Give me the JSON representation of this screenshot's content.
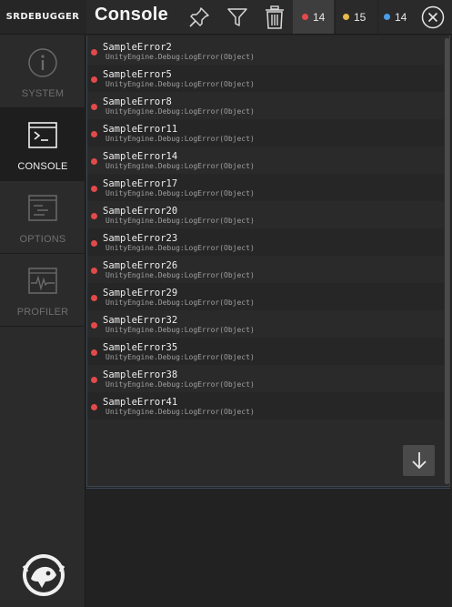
{
  "sidebar": {
    "brand": "SRDEBUGGER",
    "items": [
      {
        "label": "SYSTEM",
        "icon": "info-icon",
        "active": false
      },
      {
        "label": "CONSOLE",
        "icon": "terminal-icon",
        "active": true
      },
      {
        "label": "OPTIONS",
        "icon": "options-icon",
        "active": false
      },
      {
        "label": "PROFILER",
        "icon": "profiler-icon",
        "active": false
      }
    ],
    "logo_icon": "srdebugger-logo-icon"
  },
  "header": {
    "title": "Console",
    "buttons": [
      "pin-icon",
      "filter-icon",
      "trash-icon",
      "close-icon"
    ],
    "counts": {
      "error": "14",
      "warning": "15",
      "info": "14"
    }
  },
  "colors": {
    "error": "#e24a4a",
    "warning": "#e8b84a",
    "info": "#4a9ee8",
    "panel_border": "#3a4552"
  },
  "log": {
    "entries": [
      {
        "message": "SampleError2",
        "trace": "UnityEngine.Debug:LogError(Object)"
      },
      {
        "message": "SampleError5",
        "trace": "UnityEngine.Debug:LogError(Object)"
      },
      {
        "message": "SampleError8",
        "trace": "UnityEngine.Debug:LogError(Object)"
      },
      {
        "message": "SampleError11",
        "trace": "UnityEngine.Debug:LogError(Object)"
      },
      {
        "message": "SampleError14",
        "trace": "UnityEngine.Debug:LogError(Object)"
      },
      {
        "message": "SampleError17",
        "trace": "UnityEngine.Debug:LogError(Object)"
      },
      {
        "message": "SampleError20",
        "trace": "UnityEngine.Debug:LogError(Object)"
      },
      {
        "message": "SampleError23",
        "trace": "UnityEngine.Debug:LogError(Object)"
      },
      {
        "message": "SampleError26",
        "trace": "UnityEngine.Debug:LogError(Object)"
      },
      {
        "message": "SampleError29",
        "trace": "UnityEngine.Debug:LogError(Object)"
      },
      {
        "message": "SampleError32",
        "trace": "UnityEngine.Debug:LogError(Object)"
      },
      {
        "message": "SampleError35",
        "trace": "UnityEngine.Debug:LogError(Object)"
      },
      {
        "message": "SampleError38",
        "trace": "UnityEngine.Debug:LogError(Object)"
      },
      {
        "message": "SampleError41",
        "trace": "UnityEngine.Debug:LogError(Object)"
      }
    ]
  }
}
